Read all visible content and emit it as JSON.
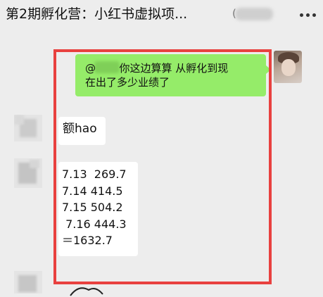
{
  "header": {
    "title": "第2期孵化营：小红书虚拟项...",
    "paren": "("
  },
  "messages": [
    {
      "side": "right",
      "text_parts": [
        "@",
        "  你这边算算 从孵化到现",
        "在出了多少业绩了"
      ]
    },
    {
      "side": "left",
      "text": "额hao"
    },
    {
      "side": "left",
      "lines": [
        "7.13  269.7",
        "7.14 414.5",
        "7.15 504.2",
        " 7.16 444.3",
        "＝1632.7"
      ]
    }
  ],
  "colors": {
    "background": "#ededed",
    "sent_bubble": "#95ec69",
    "received_bubble": "#ffffff",
    "highlight_frame": "#e8413f"
  },
  "icons": {
    "more": "more-dots-icon"
  }
}
